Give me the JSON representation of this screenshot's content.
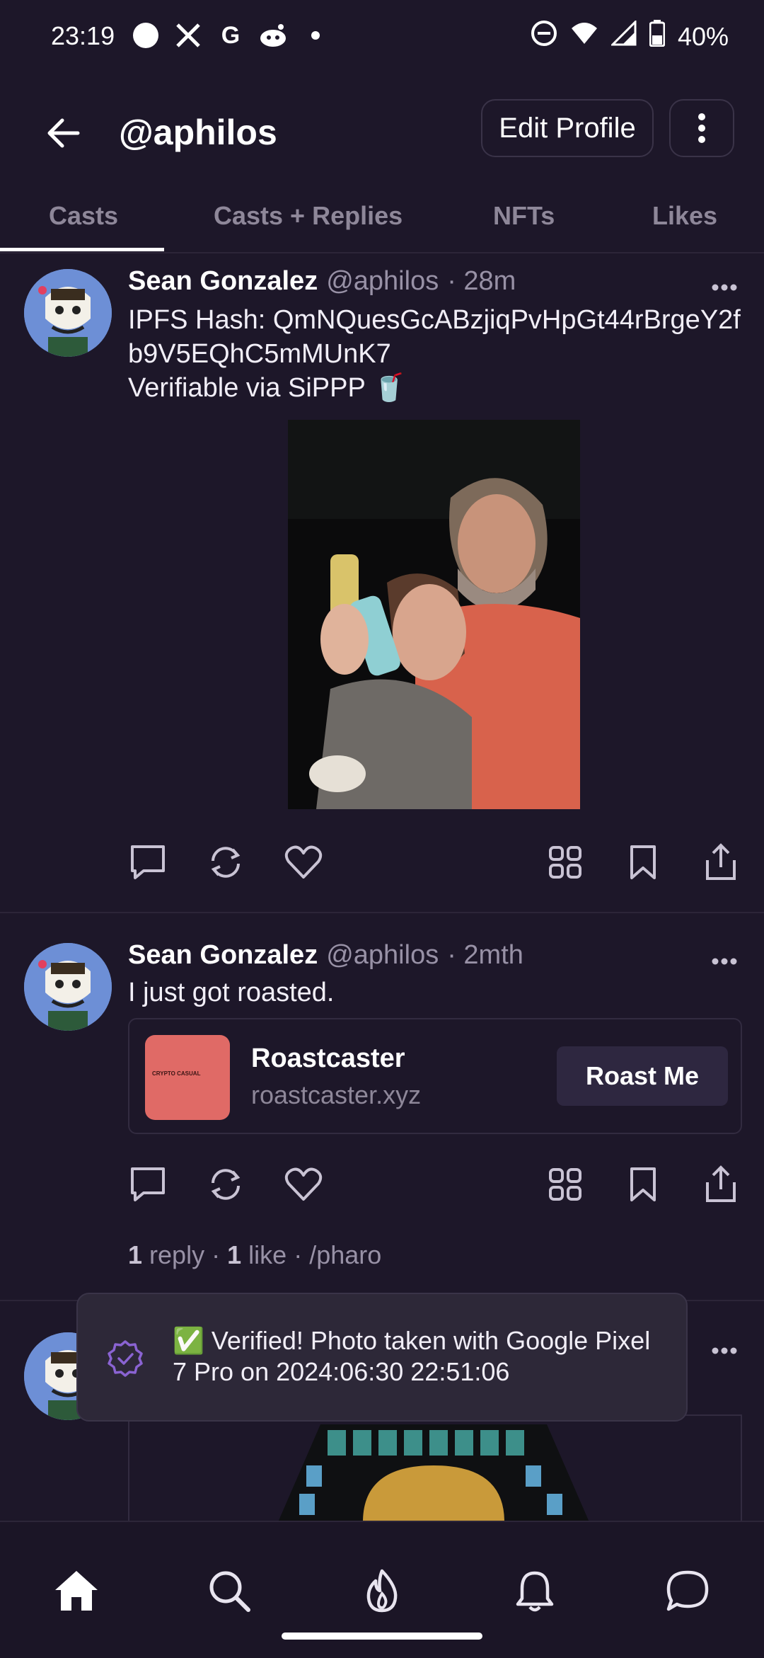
{
  "status_bar": {
    "time": "23:19",
    "battery": "40%",
    "left_icons": [
      "circle-icon",
      "x-icon",
      "google-icon",
      "reddit-icon",
      "dot-icon"
    ],
    "right_icons": [
      "dnd-icon",
      "wifi-icon",
      "signal-icon",
      "battery-icon"
    ]
  },
  "header": {
    "handle": "@aphilos",
    "edit_profile": "Edit Profile"
  },
  "tabs": [
    {
      "label": "Casts",
      "active": true
    },
    {
      "label": "Casts + Replies",
      "active": false
    },
    {
      "label": "NFTs",
      "active": false
    },
    {
      "label": "Likes",
      "active": false
    }
  ],
  "posts": [
    {
      "name": "Sean Gonzalez",
      "handle": "@aphilos",
      "time": "· 28m",
      "text_line1": "IPFS Hash: QmNQuesGcABzjiqPvHpGt44rBrgeY2f",
      "text_line2": "b9V5EQhC5mMUnK7",
      "text_line3": "Verifiable via SiPPP 🥤",
      "image_alt": "photo"
    },
    {
      "name": "Sean Gonzalez",
      "handle": "@aphilos",
      "time": "· 2mth",
      "text": "I just got roasted.",
      "embed": {
        "thumb_text": "CRYPTO CASUAL",
        "title": "Roastcaster",
        "url": "roastcaster.xyz",
        "button": "Roast Me"
      },
      "stats": {
        "reply_count": "1",
        "reply_label": "reply",
        "like_count": "1",
        "like_label": "like",
        "channel": "/pharo",
        "sep": "·"
      }
    }
  ],
  "toast": {
    "text": "✅ Verified! Photo taken with Google Pixel 7 Pro on 2024:06:30 22:51:06"
  },
  "colors": {
    "background": "#1d1729",
    "accent": "#8a63d2"
  }
}
